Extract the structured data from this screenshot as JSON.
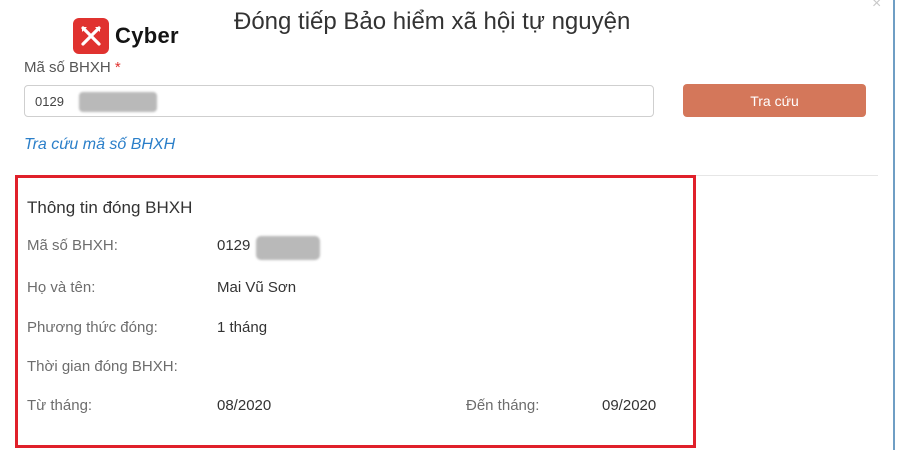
{
  "brand": {
    "name": "Cyber",
    "color": "#e0322f"
  },
  "dialog": {
    "title": "Đóng tiếp Bảo hiểm xã hội tự nguyện",
    "close_icon": "close-icon"
  },
  "search": {
    "label": "Mã số BHXH",
    "required_mark": "*",
    "value": "0129",
    "button_label": "Tra cứu",
    "button_color": "#d4775a",
    "lookup_link": "Tra cứu mã số BHXH"
  },
  "info": {
    "title": "Thông tin đóng BHXH",
    "highlight_color": "#e0202a",
    "rows": [
      {
        "label": "Mã số BHXH:",
        "value": "0129"
      },
      {
        "label": "Họ và tên:",
        "value": "Mai Vũ Sơn"
      },
      {
        "label": "Phương thức đóng:",
        "value": "1 tháng"
      },
      {
        "label": "Thời gian đóng BHXH:",
        "value": ""
      },
      {
        "label": "Từ tháng:",
        "value": "08/2020"
      }
    ],
    "to_label": "Đến tháng:",
    "to_value": "09/2020"
  }
}
